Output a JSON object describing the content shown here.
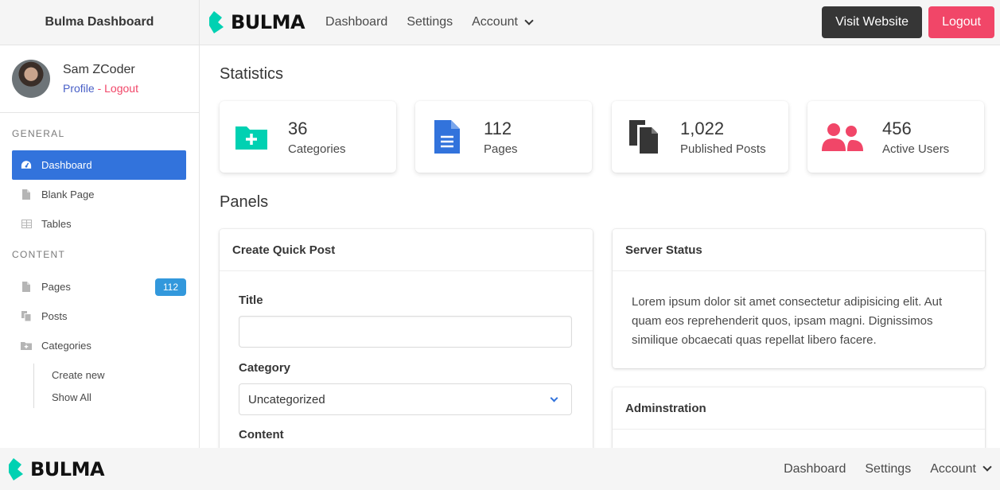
{
  "brand": {
    "app_title": "Bulma Dashboard",
    "logo_text": "BULMA",
    "logo_color": "#00d1b2"
  },
  "topnav": {
    "links": [
      "Dashboard",
      "Settings"
    ],
    "account_label": "Account",
    "visit_label": "Visit Website",
    "logout_label": "Logout"
  },
  "user": {
    "name": "Sam ZCoder",
    "profile_link": "Profile",
    "separator": "-",
    "logout_link": "Logout"
  },
  "sidebar": {
    "general_label": "General",
    "general_items": [
      {
        "label": "Dashboard",
        "icon": "dashboard-icon",
        "active": true
      },
      {
        "label": "Blank Page",
        "icon": "file-icon"
      },
      {
        "label": "Tables",
        "icon": "table-icon"
      }
    ],
    "content_label": "Content",
    "content_items": [
      {
        "label": "Pages",
        "icon": "file-icon",
        "badge": "112"
      },
      {
        "label": "Posts",
        "icon": "copy-icon"
      },
      {
        "label": "Categories",
        "icon": "folder-plus-icon"
      }
    ],
    "submenu": [
      "Create new",
      "Show All"
    ]
  },
  "main": {
    "statistics_title": "Statistics",
    "stats": [
      {
        "value": "36",
        "label": "Categories",
        "icon": "folder-plus-icon",
        "color": "#00d1b2"
      },
      {
        "value": "112",
        "label": "Pages",
        "icon": "file-alt-icon",
        "color": "#3273dc"
      },
      {
        "value": "1,022",
        "label": "Published Posts",
        "icon": "copy-icon",
        "color": "#363636"
      },
      {
        "value": "456",
        "label": "Active Users",
        "icon": "users-icon",
        "color": "#f14668"
      }
    ],
    "panels_title": "Panels",
    "quick_post": {
      "title": "Create Quick Post",
      "title_label": "Title",
      "title_value": "",
      "category_label": "Category",
      "category_value": "Uncategorized",
      "content_label": "Content"
    },
    "server_status": {
      "title": "Server Status",
      "body": "Lorem ipsum dolor sit amet consectetur adipisicing elit. Aut quam eos reprehenderit quos, ipsam magni. Dignissimos similique obcaecati quas repellat libero facere."
    },
    "administration": {
      "title": "Adminstration"
    }
  },
  "footer": {
    "logo_text": "BULMA",
    "links": [
      "Dashboard",
      "Settings"
    ],
    "account_label": "Account"
  }
}
